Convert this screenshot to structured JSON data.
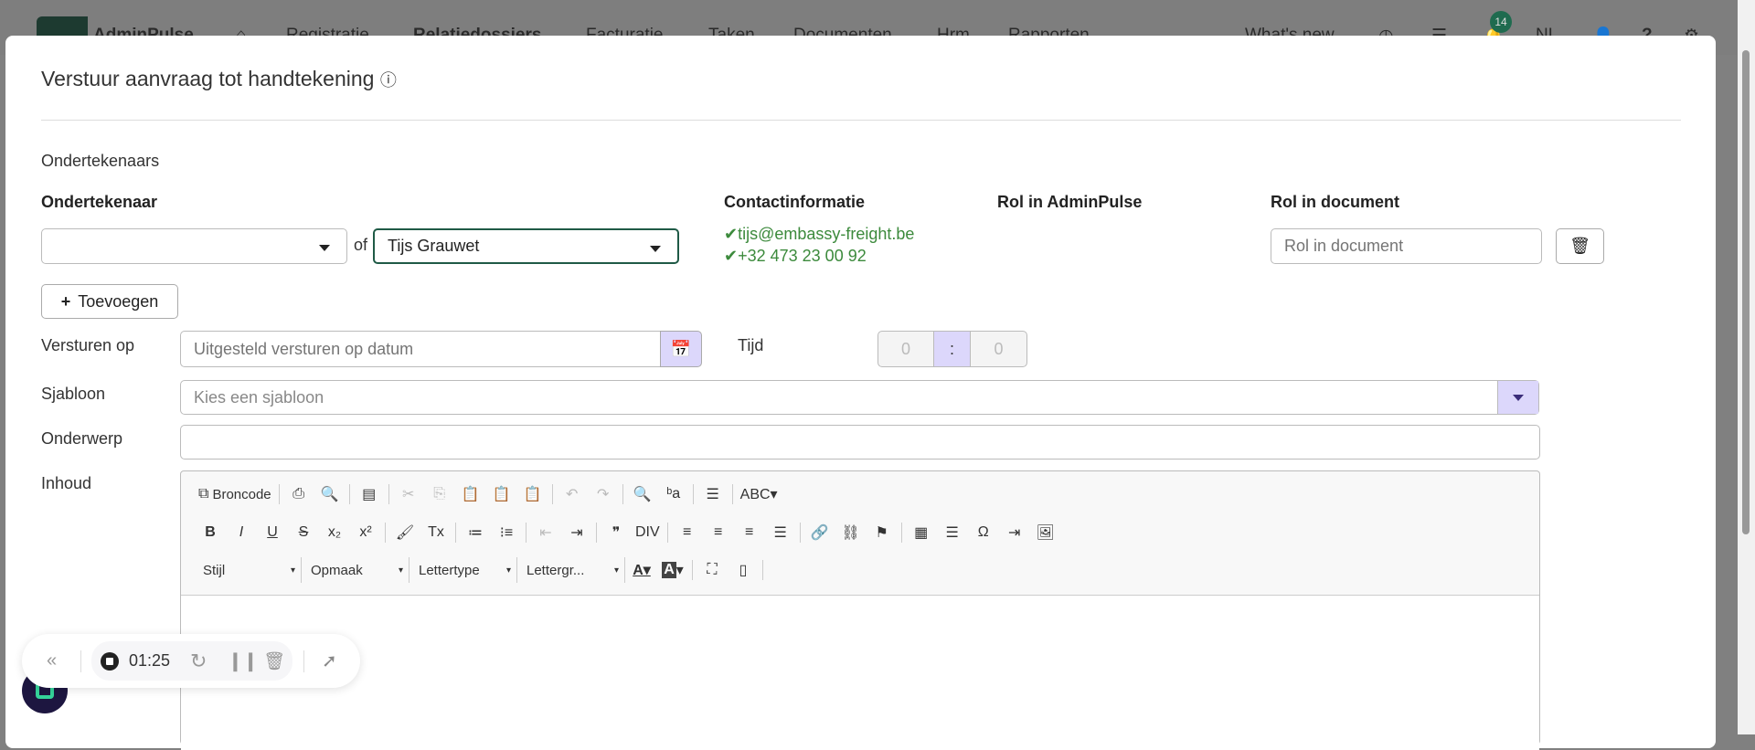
{
  "topnav": {
    "brand": "AdminPulse",
    "items": [
      "Registratie",
      "Relatiedossiers",
      "Facturatie",
      "Taken",
      "Documenten",
      "Hrm",
      "Rapporten"
    ],
    "whats_new": "What's new",
    "notifications": "14",
    "lang": "NL",
    "help": "?"
  },
  "modal": {
    "title": "Verstuur aanvraag tot handtekening",
    "section": "Ondertekenaars",
    "headers": {
      "signer": "Ondertekenaar",
      "contact": "Contactinformatie",
      "role_ap": "Rol in AdminPulse",
      "role_doc": "Rol in document"
    },
    "of": "of",
    "signer_value": "Tijs Grauwet",
    "email": "tijs@embassy-freight.be",
    "phone": "+32 473 23 00 92",
    "role_placeholder": "Rol in document",
    "add_label": "Toevoegen",
    "send_on_label": "Versturen op",
    "send_on_placeholder": "Uitgesteld versturen op datum",
    "time_label": "Tijd",
    "hour": "0",
    "colon": ":",
    "minute": "0",
    "template_label": "Sjabloon",
    "template_placeholder": "Kies een sjabloon",
    "subject_label": "Onderwerp",
    "content_label": "Inhoud"
  },
  "editor": {
    "source": "Broncode",
    "combos": [
      "Stijl",
      "Opmaak",
      "Lettertype",
      "Lettergr..."
    ],
    "row1": [
      [
        "source-icon",
        "⧉"
      ],
      "|",
      [
        "templates-icon",
        "⎙"
      ],
      [
        "preview-icon",
        "🔍"
      ],
      "|",
      [
        "new-page-icon",
        "▤"
      ],
      "|",
      [
        "cut-icon",
        "✂",
        1
      ],
      [
        "copy-icon",
        "⎘",
        1
      ],
      [
        "paste-icon",
        "📋"
      ],
      [
        "paste-text-icon",
        "📋"
      ],
      [
        "paste-word-icon",
        "📋"
      ],
      "|",
      [
        "undo-icon",
        "↶",
        1
      ],
      [
        "redo-icon",
        "↷",
        1
      ],
      "|",
      [
        "find-icon",
        "🔍"
      ],
      [
        "replace-icon",
        "ᵇa"
      ],
      "|",
      [
        "select-all-icon",
        "☰"
      ],
      "|",
      [
        "spellcheck-icon",
        "ABC▾"
      ]
    ],
    "row2": [
      [
        "bold-icon",
        "B"
      ],
      [
        "italic-icon",
        "I"
      ],
      [
        "underline-icon",
        "U"
      ],
      [
        "strike-icon",
        "S"
      ],
      [
        "subscript-icon",
        "x₂"
      ],
      [
        "superscript-icon",
        "x²"
      ],
      "|",
      [
        "format-painter-icon",
        "🖌"
      ],
      [
        "remove-format-icon",
        "Tx"
      ],
      "|",
      [
        "numbered-list-icon",
        "≔"
      ],
      [
        "bullet-list-icon",
        "⁝≡"
      ],
      "|",
      [
        "outdent-icon",
        "⇤",
        1
      ],
      [
        "indent-icon",
        "⇥"
      ],
      "|",
      [
        "blockquote-icon",
        "❞"
      ],
      [
        "div-icon",
        "DIV"
      ],
      "|",
      [
        "align-left-icon",
        "≡"
      ],
      [
        "align-center-icon",
        "≡"
      ],
      [
        "align-right-icon",
        "≡"
      ],
      [
        "justify-icon",
        "☰"
      ],
      "|",
      [
        "link-icon",
        "🔗"
      ],
      [
        "unlink-icon",
        "⛓"
      ],
      [
        "anchor-icon",
        "⚑"
      ],
      "|",
      [
        "table-icon",
        "▦"
      ],
      [
        "hr-icon",
        "☰"
      ],
      [
        "special-char-icon",
        "Ω"
      ],
      [
        "page-break-icon",
        "⇥"
      ],
      [
        "image-icon",
        "🖼"
      ]
    ]
  },
  "recorder": {
    "time": "01:25"
  },
  "colors": {
    "green": "#3c8a3c",
    "accent": "#dcd7fb",
    "focus": "#1f5a46"
  }
}
